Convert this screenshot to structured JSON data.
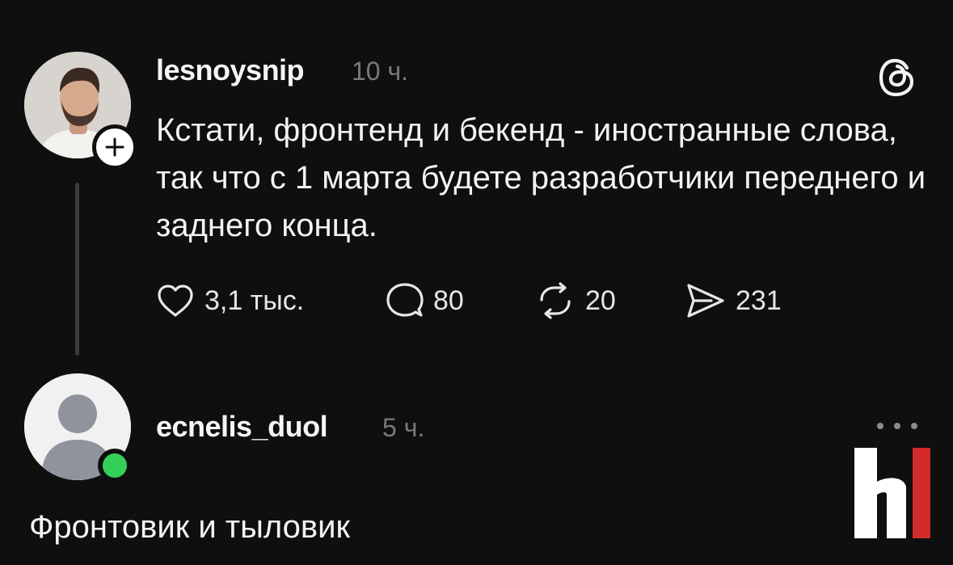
{
  "post": {
    "username": "lesnoysnip",
    "time": "10 ч.",
    "text": "Кстати, фронтенд и бекенд - иностранные слова, так что с 1 марта будете разработчики переднего и заднего конца.",
    "actions": {
      "likes": "3,1 тыс.",
      "comments": "80",
      "reposts": "20",
      "shares": "231"
    }
  },
  "reply": {
    "username": "ecnelis_duol",
    "time": "5 ч.",
    "text": "Фронтовик и тыловик"
  },
  "icons": {
    "app_logo": "threads-icon",
    "like": "heart-icon",
    "comment": "comment-bubble-icon",
    "repost": "repost-icon",
    "share": "send-icon",
    "follow": "plus-icon",
    "more": "more-dots-icon"
  },
  "colors": {
    "background": "#0f0f0f",
    "text": "#f3f3f3",
    "muted": "#7a7a7a",
    "online": "#35d05a",
    "watermark_red": "#d32a2a"
  }
}
